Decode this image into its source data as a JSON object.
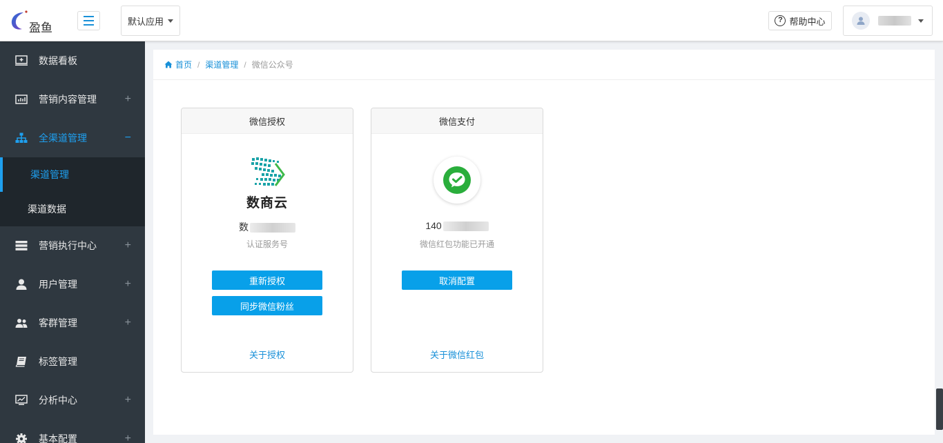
{
  "header": {
    "logo_text": "盈鱼",
    "app_select": "默认应用",
    "help_label": "帮助中心"
  },
  "sidebar": {
    "items": [
      {
        "label": "数据看板",
        "icon": "dashboard-icon",
        "sign": ""
      },
      {
        "label": "营销内容管理",
        "icon": "bar-chart-icon",
        "sign": "+"
      },
      {
        "label": "全渠道管理",
        "icon": "sitemap-icon",
        "sign": "−"
      },
      {
        "label": "营销执行中心",
        "icon": "server-icon",
        "sign": "+"
      },
      {
        "label": "用户管理",
        "icon": "user-icon",
        "sign": "+"
      },
      {
        "label": "客群管理",
        "icon": "users-icon",
        "sign": "+"
      },
      {
        "label": "标签管理",
        "icon": "book-icon",
        "sign": ""
      },
      {
        "label": "分析中心",
        "icon": "monitor-chart-icon",
        "sign": "+"
      },
      {
        "label": "基本配置",
        "icon": "gear-icon",
        "sign": "+"
      }
    ],
    "sub_items": [
      {
        "label": "渠道管理"
      },
      {
        "label": "渠道数据"
      }
    ]
  },
  "breadcrumb": {
    "home": "首页",
    "level1": "渠道管理",
    "current": "微信公众号",
    "separator": "/"
  },
  "cards": {
    "auth": {
      "title": "微信授权",
      "brand_text": "数商云",
      "name_prefix": "数",
      "subtitle": "认证服务号",
      "btn_reauth": "重新授权",
      "btn_sync": "同步微信粉丝",
      "link": "关于授权"
    },
    "pay": {
      "title": "微信支付",
      "name_prefix": "140",
      "subtitle": "微信红包功能已开通",
      "btn_cancel": "取消配置",
      "link": "关于微信红包"
    }
  },
  "colors": {
    "accent": "#1ea0f0",
    "button": "#08a0e9",
    "sidebar_bg": "#2f3840",
    "wechat_green": "#2aae3c"
  }
}
